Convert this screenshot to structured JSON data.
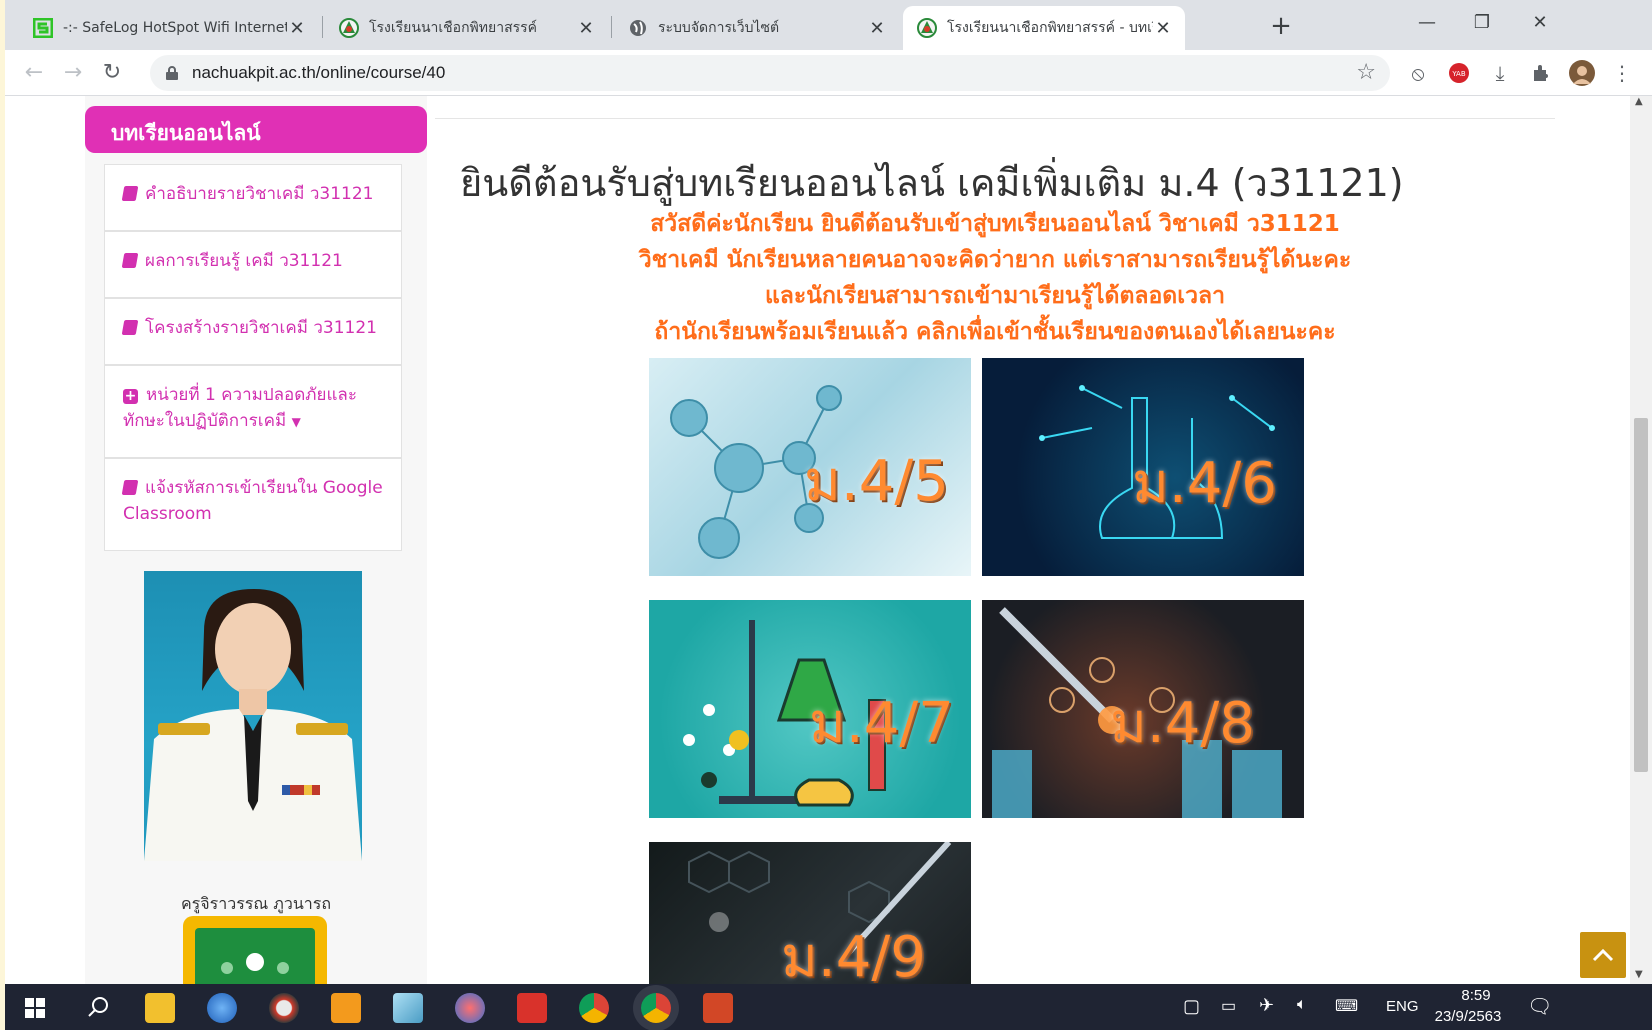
{
  "browser": {
    "tabs": [
      {
        "title": "-:- SafeLog HotSpot Wifi Internet",
        "active": false
      },
      {
        "title": "โรงเรียนนาเชือกพิทยาสรรค์",
        "active": false
      },
      {
        "title": "ระบบจัดการเว็บไซต์",
        "active": false
      },
      {
        "title": "โรงเรียนนาเชือกพิทยาสรรค์ - บทเรียนออ",
        "active": true
      }
    ],
    "url": "nachuakpit.ac.th/online/course/40"
  },
  "sidebar": {
    "heading": "บทเรียนออนไลน์",
    "items": [
      {
        "label": "คำอธิบายรายวิชาเคมี ว31121",
        "icon": "book-icon"
      },
      {
        "label": "ผลการเรียนรู้ เคมี ว31121",
        "icon": "book-icon"
      },
      {
        "label": "โครงสร้างรายวิชาเคมี ว31121",
        "icon": "book-icon"
      },
      {
        "label": "หน่วยที่ 1 ความปลอดภัยและทักษะในปฏิบัติการเคมี",
        "icon": "plus-square-icon"
      },
      {
        "label": "แจ้งรหัสการเข้าเรียนใน Google Classroom",
        "icon": "book-icon"
      }
    ],
    "teacher_name": "ครูจิราวรรณ ภูวนารถ"
  },
  "main": {
    "title": "ยินดีต้อนรับสู่บทเรียนออนไลน์ เคมีเพิ่มเติม ม.4 (ว31121)",
    "greeting": [
      "สวัสดีค่ะนักเรียน ยินดีต้อนรับเข้าสู่บทเรียนออนไลน์ วิชาเคมี ว31121",
      "วิชาเคมี นักเรียนหลายคนอาจจะคิดว่ายาก แต่เราสามารถเรียนรู้ได้นะคะ",
      "และนักเรียนสามารถเข้ามาเรียนรู้ได้ตลอดเวลา",
      "ถ้านักเรียนพร้อมเรียนแล้ว คลิกเพื่อเข้าชั้นเรียนของตนเองได้เลยนะคะ"
    ],
    "classes": [
      "ม.4/5",
      "ม.4/6",
      "ม.4/7",
      "ม.4/8",
      "ม.4/9"
    ]
  },
  "taskbar": {
    "language": "ENG",
    "time": "8:59",
    "date": "23/9/2563"
  },
  "colors": {
    "accent": "#e030b5",
    "greeting": "#ff6d1a",
    "scroll_top": "#c89211"
  }
}
